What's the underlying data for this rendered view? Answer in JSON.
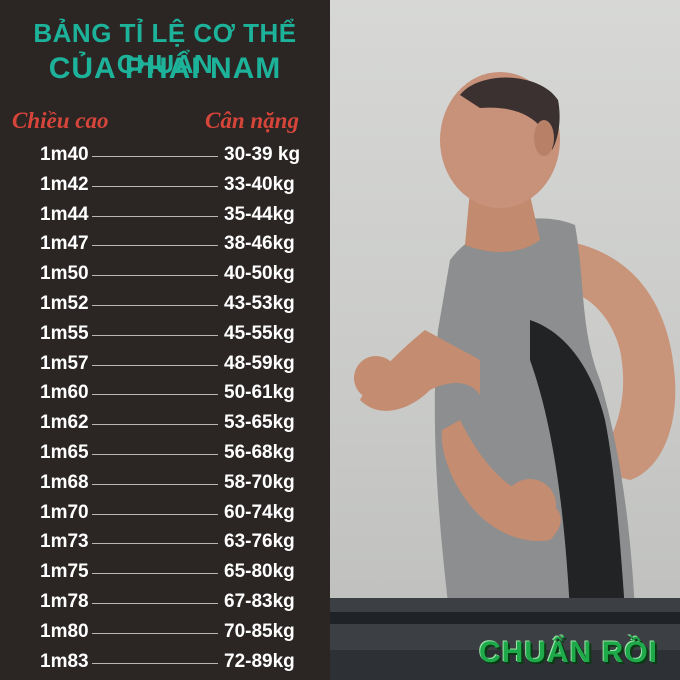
{
  "title_line1": "BẢNG TỈ LỆ CƠ THỂ CHUẨN",
  "title_line2": "CỦA PHÁI NAM",
  "header": {
    "height": "Chiều cao",
    "weight": "Cân nặng"
  },
  "rows": [
    {
      "height": "1m40",
      "weight": "30-39 kg"
    },
    {
      "height": "1m42",
      "weight": "33-40kg"
    },
    {
      "height": "1m44",
      "weight": "35-44kg"
    },
    {
      "height": "1m47",
      "weight": "38-46kg"
    },
    {
      "height": "1m50",
      "weight": "40-50kg"
    },
    {
      "height": "1m52",
      "weight": "43-53kg"
    },
    {
      "height": "1m55",
      "weight": "45-55kg"
    },
    {
      "height": "1m57",
      "weight": "48-59kg"
    },
    {
      "height": "1m60",
      "weight": "50-61kg"
    },
    {
      "height": "1m62",
      "weight": "53-65kg"
    },
    {
      "height": "1m65",
      "weight": "56-68kg"
    },
    {
      "height": "1m68",
      "weight": "58-70kg"
    },
    {
      "height": "1m70",
      "weight": "60-74kg"
    },
    {
      "height": "1m73",
      "weight": "63-76kg"
    },
    {
      "height": "1m75",
      "weight": "65-80kg"
    },
    {
      "height": "1m78",
      "weight": "67-83kg"
    },
    {
      "height": "1m80",
      "weight": "70-85kg"
    },
    {
      "height": "1m83",
      "weight": "72-89kg"
    }
  ],
  "logo": "CHUẨN RỒI",
  "colors": {
    "panel_bg": "#2b2524",
    "title": "#1db39a",
    "header": "#d6453a",
    "logo": "#1ea94a"
  },
  "photo_subject": "man-running-on-treadmill"
}
